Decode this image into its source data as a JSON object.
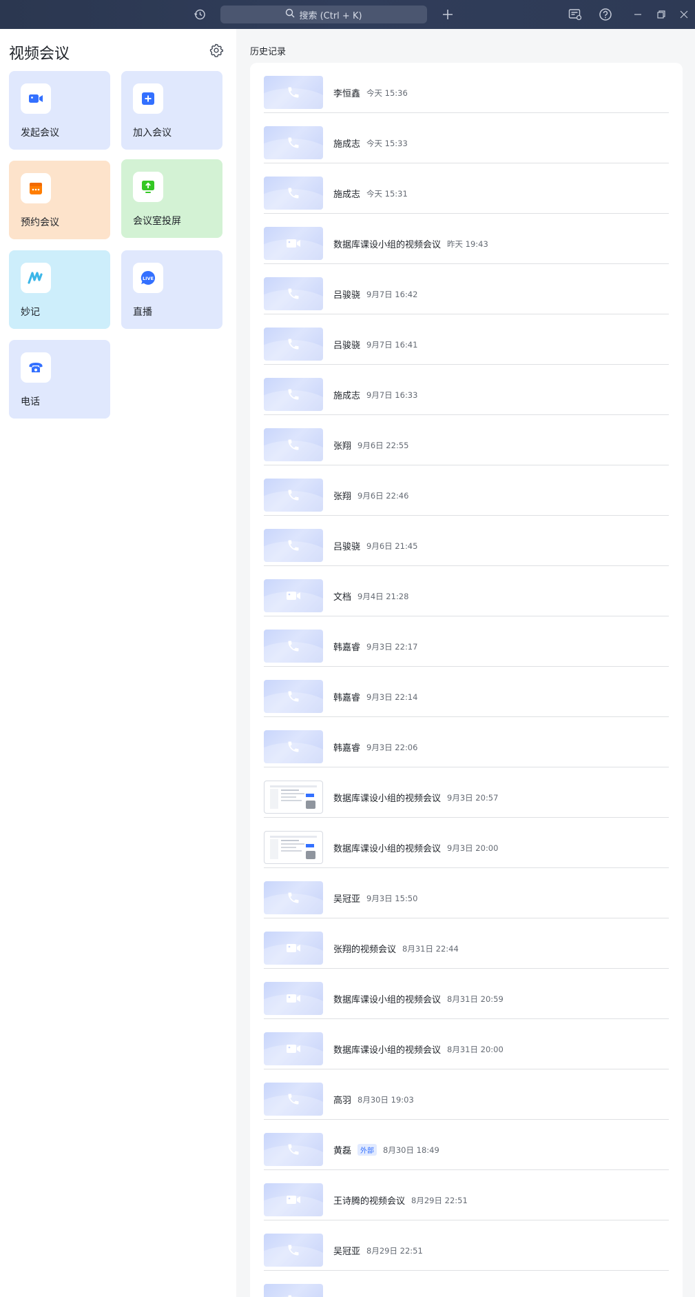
{
  "titlebar": {
    "search_placeholder": "搜索 (Ctrl + K)",
    "icons": [
      "history-icon",
      "search-icon",
      "plus-icon",
      "notification-icon",
      "help-icon",
      "minimize-icon",
      "restore-icon",
      "close-icon"
    ]
  },
  "left": {
    "title": "视频会议",
    "cards": [
      {
        "label": "发起会议",
        "icon": "video-camera-icon",
        "bg": "#e0e8fd",
        "icon_color": "#3370ff"
      },
      {
        "label": "加入会议",
        "icon": "plus-square-icon",
        "bg": "#e0e8fd",
        "icon_color": "#3370ff"
      },
      {
        "label": "预约会议",
        "icon": "calendar-icon",
        "bg": "#fde3cb",
        "icon_color": "#ff7d00"
      },
      {
        "label": "会议室投屏",
        "icon": "screen-share-icon",
        "bg": "#d3f2d4",
        "icon_color": "#34c724"
      },
      {
        "label": "妙记",
        "icon": "minutes-icon",
        "bg": "#cdeefb",
        "icon_color": "#3cb6e8"
      },
      {
        "label": "直播",
        "icon": "live-icon",
        "bg": "#e0e8fd",
        "icon_color": "#3370ff"
      },
      {
        "label": "电话",
        "icon": "phone-icon",
        "bg": "#e0e8fd",
        "icon_color": "#3370ff"
      }
    ]
  },
  "history": {
    "title": "历史记录",
    "items": [
      {
        "name": "李恒鑫",
        "time": "今天 15:36",
        "kind": "phone"
      },
      {
        "name": "施成志",
        "time": "今天 15:33",
        "kind": "phone"
      },
      {
        "name": "施成志",
        "time": "今天 15:31",
        "kind": "phone"
      },
      {
        "name": "数据库课设小组的视频会议",
        "time": "昨天 19:43",
        "kind": "video"
      },
      {
        "name": "吕骏骁",
        "time": "9月7日 16:42",
        "kind": "phone"
      },
      {
        "name": "吕骏骁",
        "time": "9月7日 16:41",
        "kind": "phone"
      },
      {
        "name": "施成志",
        "time": "9月7日 16:33",
        "kind": "phone"
      },
      {
        "name": "张翔",
        "time": "9月6日 22:55",
        "kind": "phone"
      },
      {
        "name": "张翔",
        "time": "9月6日 22:46",
        "kind": "phone"
      },
      {
        "name": "吕骏骁",
        "time": "9月6日 21:45",
        "kind": "phone"
      },
      {
        "name": "文档",
        "time": "9月4日 21:28",
        "kind": "video"
      },
      {
        "name": "韩嘉睿",
        "time": "9月3日 22:17",
        "kind": "phone"
      },
      {
        "name": "韩嘉睿",
        "time": "9月3日 22:14",
        "kind": "phone"
      },
      {
        "name": "韩嘉睿",
        "time": "9月3日 22:06",
        "kind": "phone"
      },
      {
        "name": "数据库课设小组的视频会议",
        "time": "9月3日 20:57",
        "kind": "recording"
      },
      {
        "name": "数据库课设小组的视频会议",
        "time": "9月3日 20:00",
        "kind": "recording"
      },
      {
        "name": "吴冠亚",
        "time": "9月3日 15:50",
        "kind": "phone"
      },
      {
        "name": "张翔的视频会议",
        "time": "8月31日 22:44",
        "kind": "video"
      },
      {
        "name": "数据库课设小组的视频会议",
        "time": "8月31日 20:59",
        "kind": "video"
      },
      {
        "name": "数据库课设小组的视频会议",
        "time": "8月31日 20:00",
        "kind": "video"
      },
      {
        "name": "高羽",
        "time": "8月30日 19:03",
        "kind": "phone"
      },
      {
        "name": "黄磊",
        "badge": "外部",
        "time": "8月30日 18:49",
        "kind": "phone"
      },
      {
        "name": "王诗腾的视频会议",
        "time": "8月29日 22:51",
        "kind": "video"
      },
      {
        "name": "吴冠亚",
        "time": "8月29日 22:51",
        "kind": "phone"
      },
      {
        "name": "",
        "time": "",
        "kind": "phone"
      }
    ]
  }
}
